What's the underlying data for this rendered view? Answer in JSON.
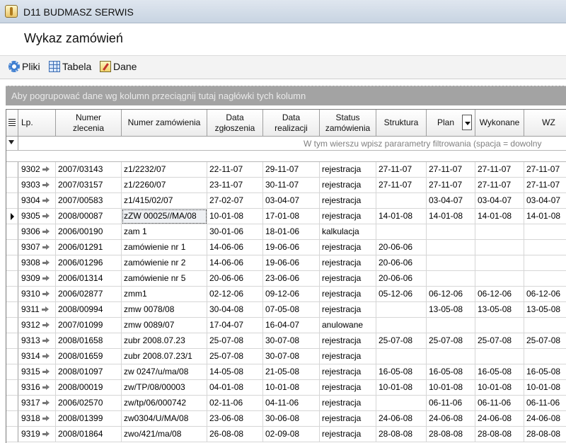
{
  "window": {
    "title": "D11 BUDMASZ SERWIS"
  },
  "form": {
    "title": "Wykaz zamówień"
  },
  "toolbar": {
    "items": [
      {
        "label": "Pliki",
        "icon": "plug-icon"
      },
      {
        "label": "Tabela",
        "icon": "table-icon"
      },
      {
        "label": "Dane",
        "icon": "data-edit-icon"
      }
    ]
  },
  "grid": {
    "group_hint": "Aby pogrupować dane wg kolumn przeciągnij tutaj nagłówki tych kolumn",
    "filter_hint": "W tym wierszu wpisz pararametry filtrowania (spacja = dowolny",
    "columns": [
      {
        "key": "lp",
        "label": "Lp."
      },
      {
        "key": "nr_zlecenia",
        "label": "Numer zlecenia"
      },
      {
        "key": "nr_zamowienia",
        "label": "Numer zamówienia"
      },
      {
        "key": "data_zgl",
        "label": "Data zgłoszenia"
      },
      {
        "key": "data_real",
        "label": "Data realizacji"
      },
      {
        "key": "status",
        "label": "Status zamówienia"
      },
      {
        "key": "struktura",
        "label": "Struktura"
      },
      {
        "key": "plan",
        "label": "Plan"
      },
      {
        "key": "wykonane",
        "label": "Wykonane"
      },
      {
        "key": "wz",
        "label": "WZ"
      }
    ],
    "current_row": 3,
    "rows": [
      [
        "9302",
        "2007/03143",
        "z1/2232/07",
        "22-11-07",
        "29-11-07",
        "rejestracja",
        "27-11-07",
        "27-11-07",
        "27-11-07",
        "27-11-07"
      ],
      [
        "9303",
        "2007/03157",
        "z1/2260/07",
        "23-11-07",
        "30-11-07",
        "rejestracja",
        "27-11-07",
        "27-11-07",
        "27-11-07",
        "27-11-07"
      ],
      [
        "9304",
        "2007/00583",
        "z1/415/02/07",
        "27-02-07",
        "03-04-07",
        "rejestracja",
        "",
        "03-04-07",
        "03-04-07",
        "03-04-07"
      ],
      [
        "9305",
        "2008/00087",
        "zZW 00025//MA/08",
        "10-01-08",
        "17-01-08",
        "rejestracja",
        "14-01-08",
        "14-01-08",
        "14-01-08",
        "14-01-08"
      ],
      [
        "9306",
        "2006/00190",
        "zam 1",
        "30-01-06",
        "18-01-06",
        "kalkulacja",
        "",
        "",
        "",
        ""
      ],
      [
        "9307",
        "2006/01291",
        "zamówienie nr 1",
        "14-06-06",
        "19-06-06",
        "rejestracja",
        "20-06-06",
        "",
        "",
        ""
      ],
      [
        "9308",
        "2006/01296",
        "zamówienie nr 2",
        "14-06-06",
        "19-06-06",
        "rejestracja",
        "20-06-06",
        "",
        "",
        ""
      ],
      [
        "9309",
        "2006/01314",
        "zamówienie nr 5",
        "20-06-06",
        "23-06-06",
        "rejestracja",
        "20-06-06",
        "",
        "",
        ""
      ],
      [
        "9310",
        "2006/02877",
        "zmm1",
        "02-12-06",
        "09-12-06",
        "rejestracja",
        "05-12-06",
        "06-12-06",
        "06-12-06",
        "06-12-06"
      ],
      [
        "9311",
        "2008/00994",
        "zmw 0078/08",
        "30-04-08",
        "07-05-08",
        "rejestracja",
        "",
        "13-05-08",
        "13-05-08",
        "13-05-08"
      ],
      [
        "9312",
        "2007/01099",
        "zmw 0089/07",
        "17-04-07",
        "16-04-07",
        "anulowane",
        "",
        "",
        "",
        ""
      ],
      [
        "9313",
        "2008/01658",
        "zubr 2008.07.23",
        "25-07-08",
        "30-07-08",
        "rejestracja",
        "25-07-08",
        "25-07-08",
        "25-07-08",
        "25-07-08"
      ],
      [
        "9314",
        "2008/01659",
        "zubr 2008.07.23/1",
        "25-07-08",
        "30-07-08",
        "rejestracja",
        "",
        "",
        "",
        ""
      ],
      [
        "9315",
        "2008/01097",
        "zw 0247/u/ma/08",
        "14-05-08",
        "21-05-08",
        "rejestracja",
        "16-05-08",
        "16-05-08",
        "16-05-08",
        "16-05-08"
      ],
      [
        "9316",
        "2008/00019",
        "zw/TP/08/00003",
        "04-01-08",
        "10-01-08",
        "rejestracja",
        "10-01-08",
        "10-01-08",
        "10-01-08",
        "10-01-08"
      ],
      [
        "9317",
        "2006/02570",
        "zw/tp/06/000742",
        "02-11-06",
        "04-11-06",
        "rejestracja",
        "",
        "06-11-06",
        "06-11-06",
        "06-11-06"
      ],
      [
        "9318",
        "2008/01399",
        "zw0304/U/MA/08",
        "23-06-08",
        "30-06-08",
        "rejestracja",
        "24-06-08",
        "24-06-08",
        "24-06-08",
        "24-06-08"
      ],
      [
        "9319",
        "2008/01864",
        "zwo/421/ma/08",
        "26-08-08",
        "02-09-08",
        "rejestracja",
        "28-08-08",
        "28-08-08",
        "28-08-08",
        "28-08-08"
      ]
    ]
  }
}
